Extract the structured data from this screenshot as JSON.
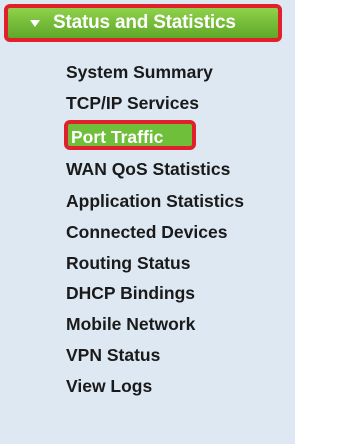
{
  "menu": {
    "section_title": "Status and Statistics",
    "items": [
      {
        "label": "System Summary"
      },
      {
        "label": "TCP/IP Services"
      },
      {
        "label": "Port Traffic"
      },
      {
        "label": "WAN QoS Statistics"
      },
      {
        "label": "Application Statistics"
      },
      {
        "label": "Connected Devices"
      },
      {
        "label": "Routing Status"
      },
      {
        "label": "DHCP Bindings"
      },
      {
        "label": "Mobile Network"
      },
      {
        "label": "VPN Status"
      },
      {
        "label": "View Logs"
      }
    ],
    "active_item": "Port Traffic"
  },
  "colors": {
    "header_green": "#6fbf3a",
    "highlight_red": "#e0202a",
    "panel_background": "#dde8f2"
  }
}
